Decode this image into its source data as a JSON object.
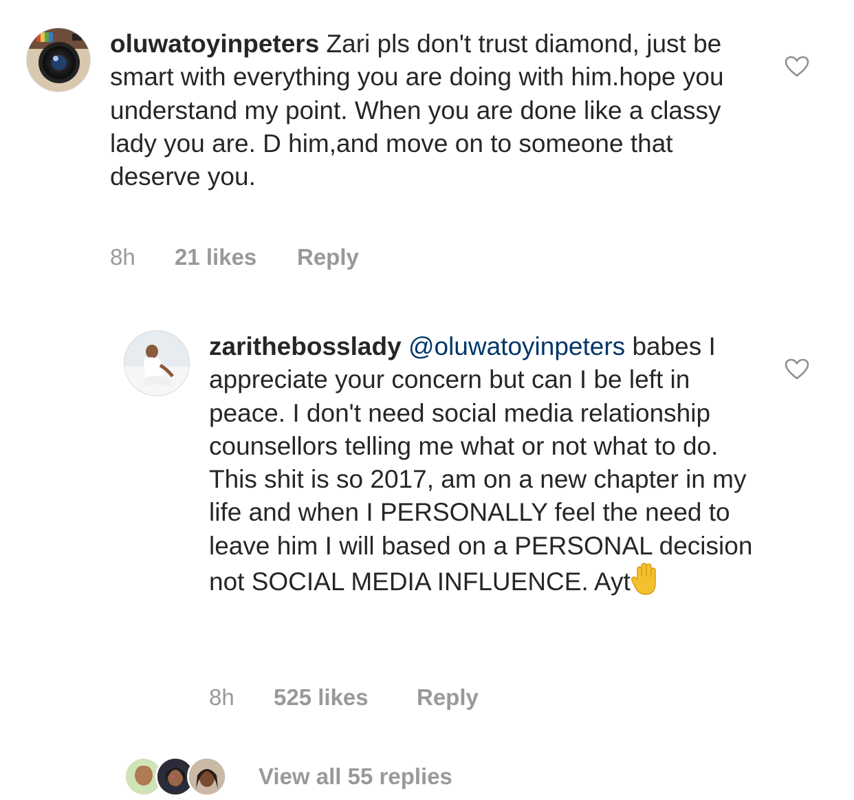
{
  "comments": [
    {
      "username": "oluwatoyinpeters",
      "text": " Zari pls don't trust diamond, just be smart with everything you are doing with him.hope you understand my point. When you are done like a classy lady you are. D him,and move on to someone that deserve you.",
      "time": "8h",
      "likes": "21 likes",
      "reply_label": "Reply",
      "avatar_icon": "instagram-camera-icon",
      "like_icon": "heart-outline-icon"
    }
  ],
  "reply": {
    "username": "zarithebosslady",
    "mention": "@oluwatoyinpeters",
    "text": "babes I appreciate your concern but can I be left in peace. I don't need social media relationship counsellors telling me what or not what to do. This shit is so 2017, am on a new chapter in my life and when I PERSONALLY feel the need to leave him I will based on a PERSONAL decision not SOCIAL MEDIA INFLUENCE. Ayt",
    "emoji_icon": "raised-hand-emoji-icon",
    "time": "8h",
    "likes": "525 likes",
    "reply_label": "Reply",
    "like_icon": "heart-outline-icon"
  },
  "view_replies": {
    "label": "View all 55 replies"
  },
  "colors": {
    "text": "#262626",
    "meta": "#999999",
    "mention": "#003569",
    "emoji": "#f5c02d"
  }
}
